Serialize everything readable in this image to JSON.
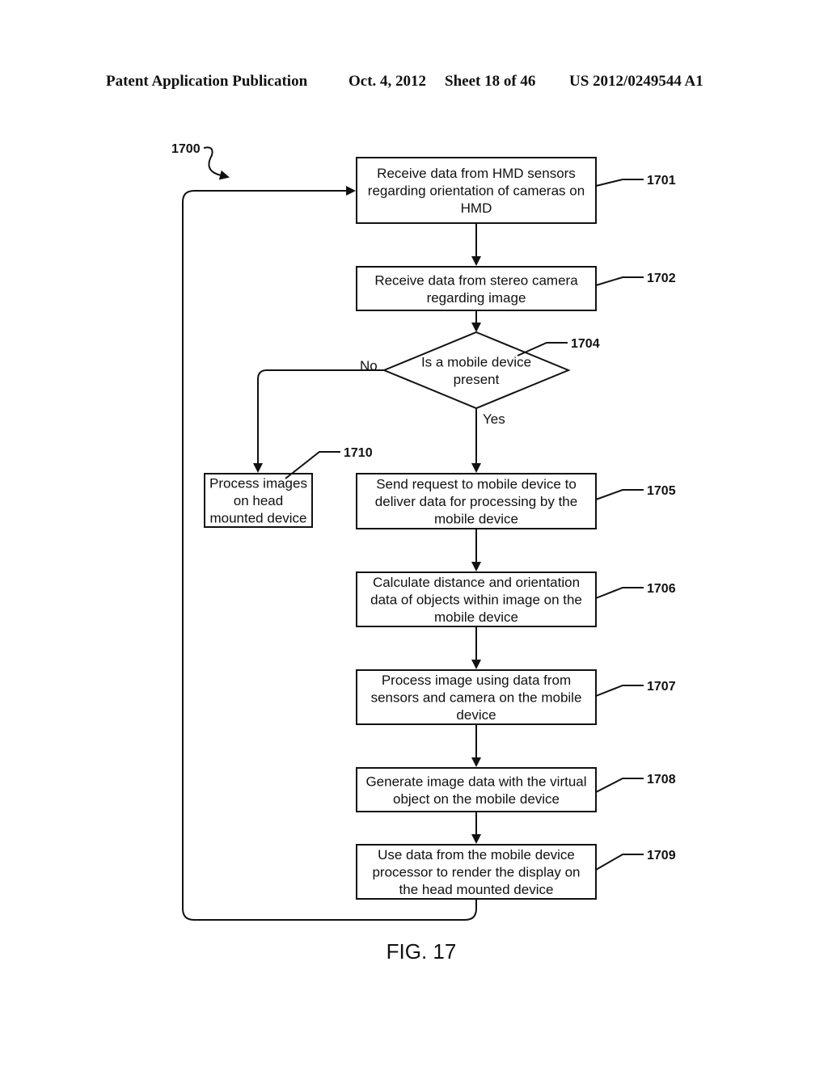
{
  "header": {
    "publication": "Patent Application Publication",
    "date": "Oct. 4, 2012",
    "sheet": "Sheet 18 of 46",
    "number": "US 2012/0249544 A1"
  },
  "figure": {
    "ref": "1700",
    "caption": "FIG. 17"
  },
  "nodes": [
    {
      "id": "1701",
      "type": "process",
      "lines": [
        "Receive data from HMD sensors",
        "regarding orientation of cameras on",
        "HMD"
      ]
    },
    {
      "id": "1702",
      "type": "process",
      "lines": [
        "Receive data from stereo camera",
        "regarding image"
      ]
    },
    {
      "id": "1704",
      "type": "decision",
      "lines": [
        "Is a mobile device",
        "present"
      ]
    },
    {
      "id": "1705",
      "type": "process",
      "lines": [
        "Send request to mobile device to",
        "deliver data for processing by the",
        "mobile device"
      ]
    },
    {
      "id": "1706",
      "type": "process",
      "lines": [
        "Calculate distance and orientation",
        "data of objects within image on the",
        "mobile device"
      ]
    },
    {
      "id": "1707",
      "type": "process",
      "lines": [
        "Process image using data from",
        "sensors and camera on the mobile",
        "device"
      ]
    },
    {
      "id": "1708",
      "type": "process",
      "lines": [
        "Generate image data with the virtual",
        "object on the mobile device"
      ]
    },
    {
      "id": "1709",
      "type": "process",
      "lines": [
        "Use data from the mobile device",
        "processor to render the display on",
        "the head mounted device"
      ]
    },
    {
      "id": "1710",
      "type": "process",
      "lines": [
        "Process images",
        "on head",
        "mounted device"
      ]
    }
  ],
  "edges": [
    {
      "from": "1701",
      "to": "1702",
      "label": ""
    },
    {
      "from": "1702",
      "to": "1704",
      "label": ""
    },
    {
      "from": "1704",
      "to": "1705",
      "label": "Yes"
    },
    {
      "from": "1704",
      "to": "1710",
      "label": "No"
    },
    {
      "from": "1705",
      "to": "1706",
      "label": ""
    },
    {
      "from": "1706",
      "to": "1707",
      "label": ""
    },
    {
      "from": "1707",
      "to": "1708",
      "label": ""
    },
    {
      "from": "1708",
      "to": "1709",
      "label": ""
    },
    {
      "from": "1709",
      "to": "1701",
      "label": ""
    }
  ],
  "edge_labels": {
    "yes": "Yes",
    "no": "No"
  }
}
